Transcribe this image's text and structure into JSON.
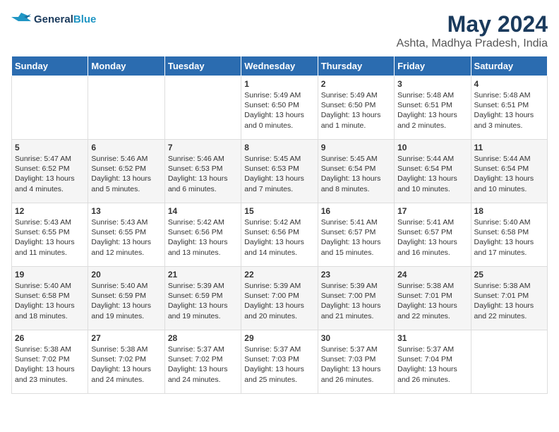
{
  "logo": {
    "line1": "General",
    "line2": "Blue"
  },
  "title": "May 2024",
  "location": "Ashta, Madhya Pradesh, India",
  "headers": [
    "Sunday",
    "Monday",
    "Tuesday",
    "Wednesday",
    "Thursday",
    "Friday",
    "Saturday"
  ],
  "weeks": [
    [
      {
        "day": "",
        "lines": []
      },
      {
        "day": "",
        "lines": []
      },
      {
        "day": "",
        "lines": []
      },
      {
        "day": "1",
        "lines": [
          "Sunrise: 5:49 AM",
          "Sunset: 6:50 PM",
          "Daylight: 13 hours",
          "and 0 minutes."
        ]
      },
      {
        "day": "2",
        "lines": [
          "Sunrise: 5:49 AM",
          "Sunset: 6:50 PM",
          "Daylight: 13 hours",
          "and 1 minute."
        ]
      },
      {
        "day": "3",
        "lines": [
          "Sunrise: 5:48 AM",
          "Sunset: 6:51 PM",
          "Daylight: 13 hours",
          "and 2 minutes."
        ]
      },
      {
        "day": "4",
        "lines": [
          "Sunrise: 5:48 AM",
          "Sunset: 6:51 PM",
          "Daylight: 13 hours",
          "and 3 minutes."
        ]
      }
    ],
    [
      {
        "day": "5",
        "lines": [
          "Sunrise: 5:47 AM",
          "Sunset: 6:52 PM",
          "Daylight: 13 hours",
          "and 4 minutes."
        ]
      },
      {
        "day": "6",
        "lines": [
          "Sunrise: 5:46 AM",
          "Sunset: 6:52 PM",
          "Daylight: 13 hours",
          "and 5 minutes."
        ]
      },
      {
        "day": "7",
        "lines": [
          "Sunrise: 5:46 AM",
          "Sunset: 6:53 PM",
          "Daylight: 13 hours",
          "and 6 minutes."
        ]
      },
      {
        "day": "8",
        "lines": [
          "Sunrise: 5:45 AM",
          "Sunset: 6:53 PM",
          "Daylight: 13 hours",
          "and 7 minutes."
        ]
      },
      {
        "day": "9",
        "lines": [
          "Sunrise: 5:45 AM",
          "Sunset: 6:54 PM",
          "Daylight: 13 hours",
          "and 8 minutes."
        ]
      },
      {
        "day": "10",
        "lines": [
          "Sunrise: 5:44 AM",
          "Sunset: 6:54 PM",
          "Daylight: 13 hours",
          "and 10 minutes."
        ]
      },
      {
        "day": "11",
        "lines": [
          "Sunrise: 5:44 AM",
          "Sunset: 6:54 PM",
          "Daylight: 13 hours",
          "and 10 minutes."
        ]
      }
    ],
    [
      {
        "day": "12",
        "lines": [
          "Sunrise: 5:43 AM",
          "Sunset: 6:55 PM",
          "Daylight: 13 hours",
          "and 11 minutes."
        ]
      },
      {
        "day": "13",
        "lines": [
          "Sunrise: 5:43 AM",
          "Sunset: 6:55 PM",
          "Daylight: 13 hours",
          "and 12 minutes."
        ]
      },
      {
        "day": "14",
        "lines": [
          "Sunrise: 5:42 AM",
          "Sunset: 6:56 PM",
          "Daylight: 13 hours",
          "and 13 minutes."
        ]
      },
      {
        "day": "15",
        "lines": [
          "Sunrise: 5:42 AM",
          "Sunset: 6:56 PM",
          "Daylight: 13 hours",
          "and 14 minutes."
        ]
      },
      {
        "day": "16",
        "lines": [
          "Sunrise: 5:41 AM",
          "Sunset: 6:57 PM",
          "Daylight: 13 hours",
          "and 15 minutes."
        ]
      },
      {
        "day": "17",
        "lines": [
          "Sunrise: 5:41 AM",
          "Sunset: 6:57 PM",
          "Daylight: 13 hours",
          "and 16 minutes."
        ]
      },
      {
        "day": "18",
        "lines": [
          "Sunrise: 5:40 AM",
          "Sunset: 6:58 PM",
          "Daylight: 13 hours",
          "and 17 minutes."
        ]
      }
    ],
    [
      {
        "day": "19",
        "lines": [
          "Sunrise: 5:40 AM",
          "Sunset: 6:58 PM",
          "Daylight: 13 hours",
          "and 18 minutes."
        ]
      },
      {
        "day": "20",
        "lines": [
          "Sunrise: 5:40 AM",
          "Sunset: 6:59 PM",
          "Daylight: 13 hours",
          "and 19 minutes."
        ]
      },
      {
        "day": "21",
        "lines": [
          "Sunrise: 5:39 AM",
          "Sunset: 6:59 PM",
          "Daylight: 13 hours",
          "and 19 minutes."
        ]
      },
      {
        "day": "22",
        "lines": [
          "Sunrise: 5:39 AM",
          "Sunset: 7:00 PM",
          "Daylight: 13 hours",
          "and 20 minutes."
        ]
      },
      {
        "day": "23",
        "lines": [
          "Sunrise: 5:39 AM",
          "Sunset: 7:00 PM",
          "Daylight: 13 hours",
          "and 21 minutes."
        ]
      },
      {
        "day": "24",
        "lines": [
          "Sunrise: 5:38 AM",
          "Sunset: 7:01 PM",
          "Daylight: 13 hours",
          "and 22 minutes."
        ]
      },
      {
        "day": "25",
        "lines": [
          "Sunrise: 5:38 AM",
          "Sunset: 7:01 PM",
          "Daylight: 13 hours",
          "and 22 minutes."
        ]
      }
    ],
    [
      {
        "day": "26",
        "lines": [
          "Sunrise: 5:38 AM",
          "Sunset: 7:02 PM",
          "Daylight: 13 hours",
          "and 23 minutes."
        ]
      },
      {
        "day": "27",
        "lines": [
          "Sunrise: 5:38 AM",
          "Sunset: 7:02 PM",
          "Daylight: 13 hours",
          "and 24 minutes."
        ]
      },
      {
        "day": "28",
        "lines": [
          "Sunrise: 5:37 AM",
          "Sunset: 7:02 PM",
          "Daylight: 13 hours",
          "and 24 minutes."
        ]
      },
      {
        "day": "29",
        "lines": [
          "Sunrise: 5:37 AM",
          "Sunset: 7:03 PM",
          "Daylight: 13 hours",
          "and 25 minutes."
        ]
      },
      {
        "day": "30",
        "lines": [
          "Sunrise: 5:37 AM",
          "Sunset: 7:03 PM",
          "Daylight: 13 hours",
          "and 26 minutes."
        ]
      },
      {
        "day": "31",
        "lines": [
          "Sunrise: 5:37 AM",
          "Sunset: 7:04 PM",
          "Daylight: 13 hours",
          "and 26 minutes."
        ]
      },
      {
        "day": "",
        "lines": []
      }
    ]
  ]
}
